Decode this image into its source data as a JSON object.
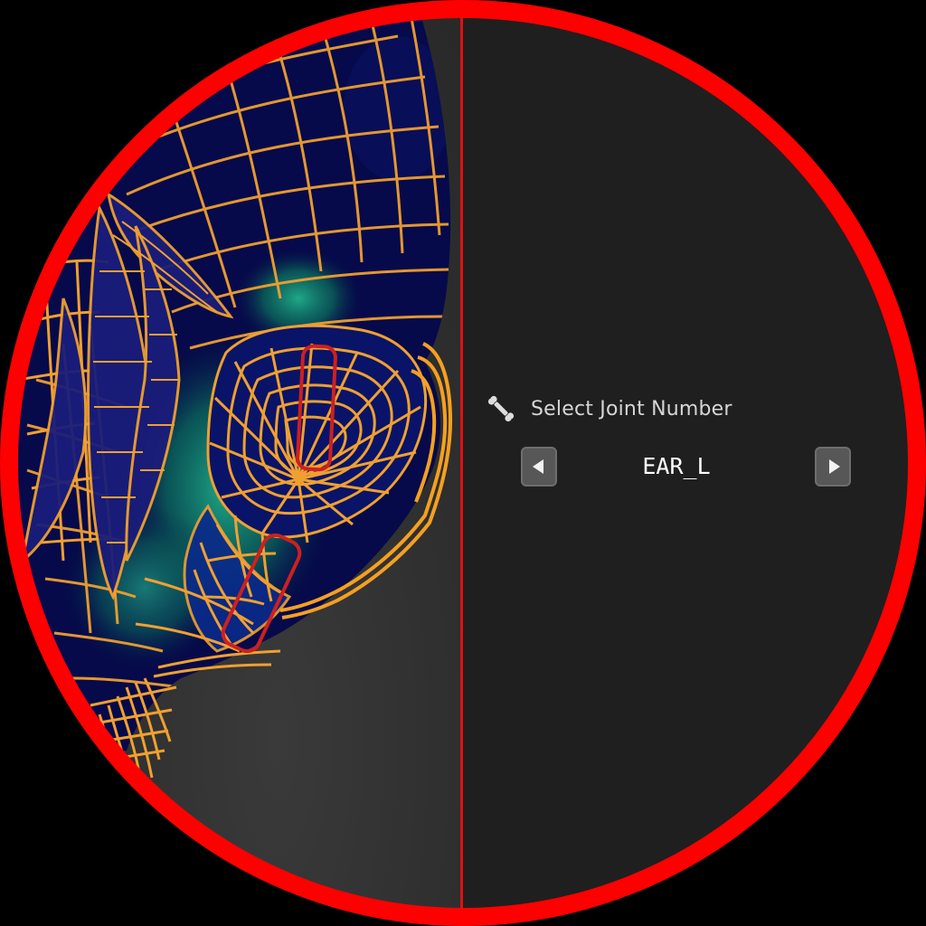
{
  "joint_selector": {
    "label": "Select Joint Number",
    "label_icon": "bone-icon",
    "value": "EAR_L",
    "prev_icon": "triangle-left-icon",
    "next_icon": "triangle-right-icon"
  },
  "colors": {
    "ring": "#ff0000",
    "wireframe": "#f0a030",
    "mesh_fill": "#060a4a",
    "selection_box": "#cc2020",
    "panel_background": "#1f1f1f"
  }
}
